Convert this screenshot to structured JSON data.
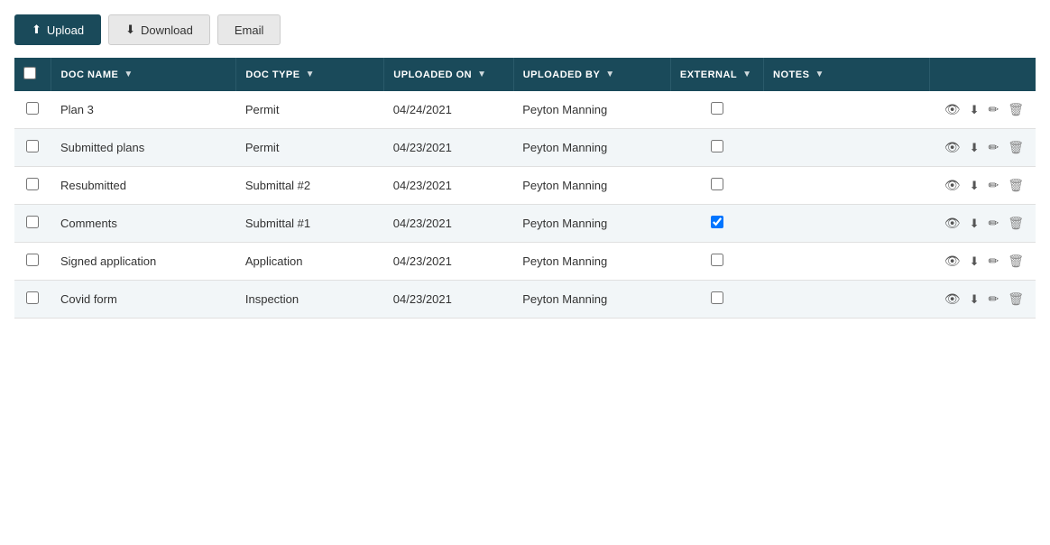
{
  "toolbar": {
    "upload_label": "Upload",
    "download_label": "Download",
    "email_label": "Email"
  },
  "table": {
    "columns": [
      {
        "key": "checkbox",
        "label": ""
      },
      {
        "key": "doc_name",
        "label": "DOC NAME"
      },
      {
        "key": "doc_type",
        "label": "DOC TYPE"
      },
      {
        "key": "uploaded_on",
        "label": "UPLOADED ON"
      },
      {
        "key": "uploaded_by",
        "label": "UPLOADED BY"
      },
      {
        "key": "external",
        "label": "EXTERNAL"
      },
      {
        "key": "notes",
        "label": "NOTES"
      },
      {
        "key": "actions",
        "label": ""
      }
    ],
    "rows": [
      {
        "id": 1,
        "doc_name": "Plan 3",
        "doc_type": "Permit",
        "uploaded_on": "04/24/2021",
        "uploaded_by": "Peyton Manning",
        "external": false,
        "notes": "",
        "highlighted": false
      },
      {
        "id": 2,
        "doc_name": "Submitted plans",
        "doc_type": "Permit",
        "uploaded_on": "04/23/2021",
        "uploaded_by": "Peyton Manning",
        "external": false,
        "notes": "",
        "highlighted": true
      },
      {
        "id": 3,
        "doc_name": "Resubmitted",
        "doc_type": "Submittal #2",
        "uploaded_on": "04/23/2021",
        "uploaded_by": "Peyton Manning",
        "external": false,
        "notes": "",
        "highlighted": false
      },
      {
        "id": 4,
        "doc_name": "Comments",
        "doc_type": "Submittal #1",
        "uploaded_on": "04/23/2021",
        "uploaded_by": "Peyton Manning",
        "external": true,
        "notes": "",
        "highlighted": true
      },
      {
        "id": 5,
        "doc_name": "Signed application",
        "doc_type": "Application",
        "uploaded_on": "04/23/2021",
        "uploaded_by": "Peyton Manning",
        "external": false,
        "notes": "",
        "highlighted": false
      },
      {
        "id": 6,
        "doc_name": "Covid form",
        "doc_type": "Inspection",
        "uploaded_on": "04/23/2021",
        "uploaded_by": "Peyton Manning",
        "external": false,
        "notes": "",
        "highlighted": true
      }
    ]
  },
  "icons": {
    "upload": "⬆",
    "download": "⬇",
    "view": "👁",
    "download_action": "⬇",
    "edit": "✏",
    "delete": "🗑",
    "filter": "▼"
  }
}
